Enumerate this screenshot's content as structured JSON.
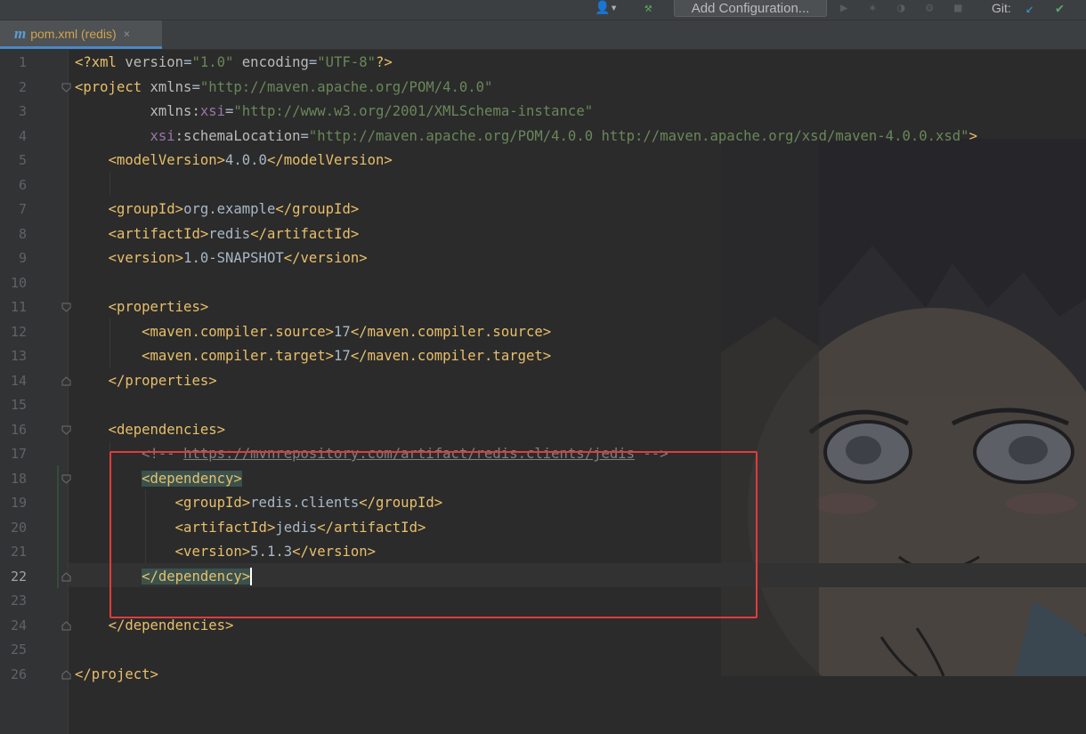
{
  "toolbar": {
    "add_config_label": "Add Configuration...",
    "git_label": "Git:",
    "icons": [
      "user-icon",
      "hammer-icon",
      "run-icon",
      "debug-icon",
      "coverage-icon",
      "profile-icon",
      "stop-icon",
      "vcs-update-icon",
      "vcs-commit-icon"
    ]
  },
  "tab": {
    "icon_letter": "m",
    "label": "pom.xml (redis)",
    "close_glyph": "×"
  },
  "editor": {
    "current_line": "22",
    "line_numbers": [
      "1",
      "2",
      "3",
      "4",
      "5",
      "6",
      "7",
      "8",
      "9",
      "10",
      "11",
      "12",
      "13",
      "14",
      "15",
      "16",
      "17",
      "18",
      "19",
      "20",
      "21",
      "22",
      "23",
      "24",
      "25",
      "26"
    ],
    "code_lines": [
      "<?xml version=\"1.0\" encoding=\"UTF-8\"?>",
      "<project xmlns=\"http://maven.apache.org/POM/4.0.0\"",
      "         xmlns:xsi=\"http://www.w3.org/2001/XMLSchema-instance\"",
      "         xsi:schemaLocation=\"http://maven.apache.org/POM/4.0.0 http://maven.apache.org/xsd/maven-4.0.0.xsd\">",
      "    <modelVersion>4.0.0</modelVersion>",
      "",
      "    <groupId>org.example</groupId>",
      "    <artifactId>redis</artifactId>",
      "    <version>1.0-SNAPSHOT</version>",
      "",
      "    <properties>",
      "        <maven.compiler.source>17</maven.compiler.source>",
      "        <maven.compiler.target>17</maven.compiler.target>",
      "    </properties>",
      "",
      "    <dependencies>",
      "        <!-- https://mvnrepository.com/artifact/redis.clients/jedis -->",
      "        <dependency>",
      "            <groupId>redis.clients</groupId>",
      "            <artifactId>jedis</artifactId>",
      "            <version>5.1.3</version>",
      "        </dependency>",
      "",
      "    </dependencies>",
      "",
      "</project>"
    ]
  }
}
